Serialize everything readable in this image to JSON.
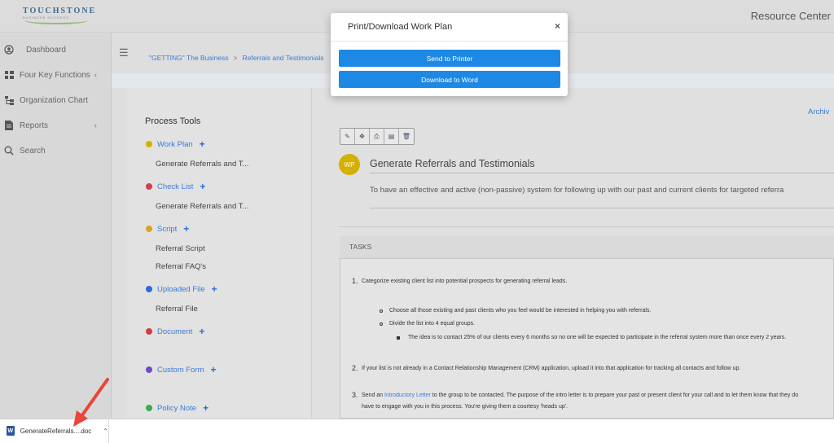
{
  "header": {
    "logo_text": "TOUCHSTONE",
    "logo_sub": "BUSINESS SUCCESS",
    "resource_center": "Resource Center"
  },
  "sidebar": {
    "items": [
      {
        "label": "Dashboard",
        "icon": "user-circle-icon",
        "has_chevron": false
      },
      {
        "label": "Four Key Functions",
        "icon": "grid-icon",
        "has_chevron": true
      },
      {
        "label": "Organization Chart",
        "icon": "org-chart-icon",
        "has_chevron": false
      },
      {
        "label": "Reports",
        "icon": "report-icon",
        "has_chevron": true
      },
      {
        "label": "Search",
        "icon": "search-icon",
        "has_chevron": false
      }
    ]
  },
  "breadcrumb": {
    "items": [
      "\"GETTING\" The Business",
      "Referrals and Testimonials"
    ],
    "separator": ">"
  },
  "process_tools": {
    "title": "Process Tools",
    "categories": [
      {
        "label": "Work Plan",
        "color": "#d4b000",
        "items": [
          "Generate Referrals and T..."
        ]
      },
      {
        "label": "Check List",
        "color": "#d63c4a",
        "items": [
          "Generate Referrals and T..."
        ]
      },
      {
        "label": "Script",
        "color": "#e0a21c",
        "items": [
          "Referral Script",
          "Referral FAQ's"
        ]
      },
      {
        "label": "Uploaded File",
        "color": "#2a6ed0",
        "items": [
          "Referral File"
        ]
      },
      {
        "label": "Document",
        "color": "#d63c4a",
        "items": []
      },
      {
        "label": "Custom Form",
        "color": "#6a4fc9",
        "items": []
      },
      {
        "label": "Policy Note",
        "color": "#3cab4a",
        "items": []
      }
    ]
  },
  "content": {
    "archive": "Archiv",
    "badge": "WP",
    "title": "Generate Referrals and Testimonials",
    "description": "To have an effective and active (non-passive) system for following up with our past and current clients for targeted referra",
    "tasks_label": "TASKS",
    "tasks": [
      {
        "num": "1.",
        "text": "Categorize existing client list into potential prospects for generating referral leads."
      },
      {
        "num": "",
        "text": "Choose all those existing and past clients who you feel would be interested in helping you with referrals."
      },
      {
        "num": "",
        "text": "Divide the list into 4 equal groups."
      },
      {
        "num": "",
        "text": "The idea is to contact 25% of our clients every 6 months so no one will be expected to participate in the referral system more than once every 2 years."
      },
      {
        "num": "2.",
        "text": "If your list is not already in a Contact Relationship Management (CRM) application, upload it into that application for tracking all contacts and follow up."
      },
      {
        "num": "3.",
        "text_pre": "Send an ",
        "link": "Introductory Letter",
        "text_post": " to the group to be contacted. The purpose of the intro letter is to prepare your past or present client for your call and to let them know that they do"
      },
      {
        "num": "",
        "text": "have to engage with you in this process. You're giving them a courtesy 'heads up'."
      }
    ]
  },
  "modal": {
    "title": "Print/Download Work Plan",
    "close": "×",
    "buttons": [
      "Send to Printer",
      "Download to Word"
    ]
  },
  "download_bar": {
    "file_name": "GenerateReferrals....doc",
    "icon": "word-doc-icon",
    "chevron": "^"
  },
  "colors": {
    "accent": "#1e88e5",
    "link": "#3a7bd5",
    "annotation_arrow": "#e8463a"
  }
}
